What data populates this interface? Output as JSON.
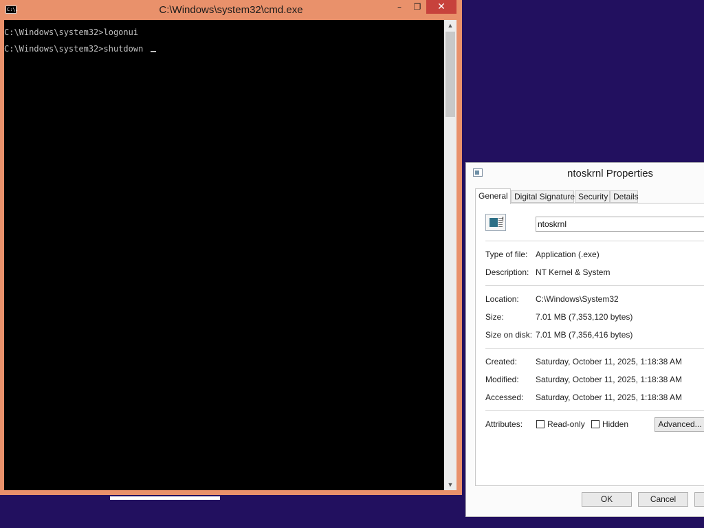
{
  "cmd": {
    "title": "C:\\Windows\\system32\\cmd.exe",
    "icon_label": "C:\\.",
    "lines": [
      "C:\\Windows\\system32>logonui",
      "C:\\Windows\\system32>shutdown "
    ],
    "buttons": {
      "minimize": "–",
      "maximize": "❐",
      "close": "✕"
    },
    "scroll_up": "▲",
    "scroll_down": "▼"
  },
  "props": {
    "title": "ntoskrnl Properties",
    "tabs": [
      "General",
      "Digital Signatures",
      "Security",
      "Details"
    ],
    "file_name": "ntoskrnl",
    "type_label": "Type of file:",
    "type_value": "Application (.exe)",
    "description_label": "Description:",
    "description_value": "NT Kernel & System",
    "location_label": "Location:",
    "location_value": "C:\\Windows\\System32",
    "size_label": "Size:",
    "size_value": "7.01 MB (7,353,120 bytes)",
    "size_on_disk_label": "Size on disk:",
    "size_on_disk_value": "7.01 MB (7,356,416 bytes)",
    "created_label": "Created:",
    "created_value": "Saturday, October 11, 2025, 1:18:38 AM",
    "modified_label": "Modified:",
    "modified_value": "Saturday, October 11, 2025, 1:18:38 AM",
    "accessed_label": "Accessed:",
    "accessed_value": "Saturday, October 11, 2025, 1:18:38 AM",
    "attributes_label": "Attributes:",
    "readonly_label": "Read-only",
    "hidden_label": "Hidden",
    "advanced_label": "Advanced...",
    "ok_label": "OK",
    "cancel_label": "Cancel"
  },
  "colors": {
    "desktop": "#22105f",
    "cmd_frame": "#e9916b",
    "close_button": "#c7423c"
  }
}
